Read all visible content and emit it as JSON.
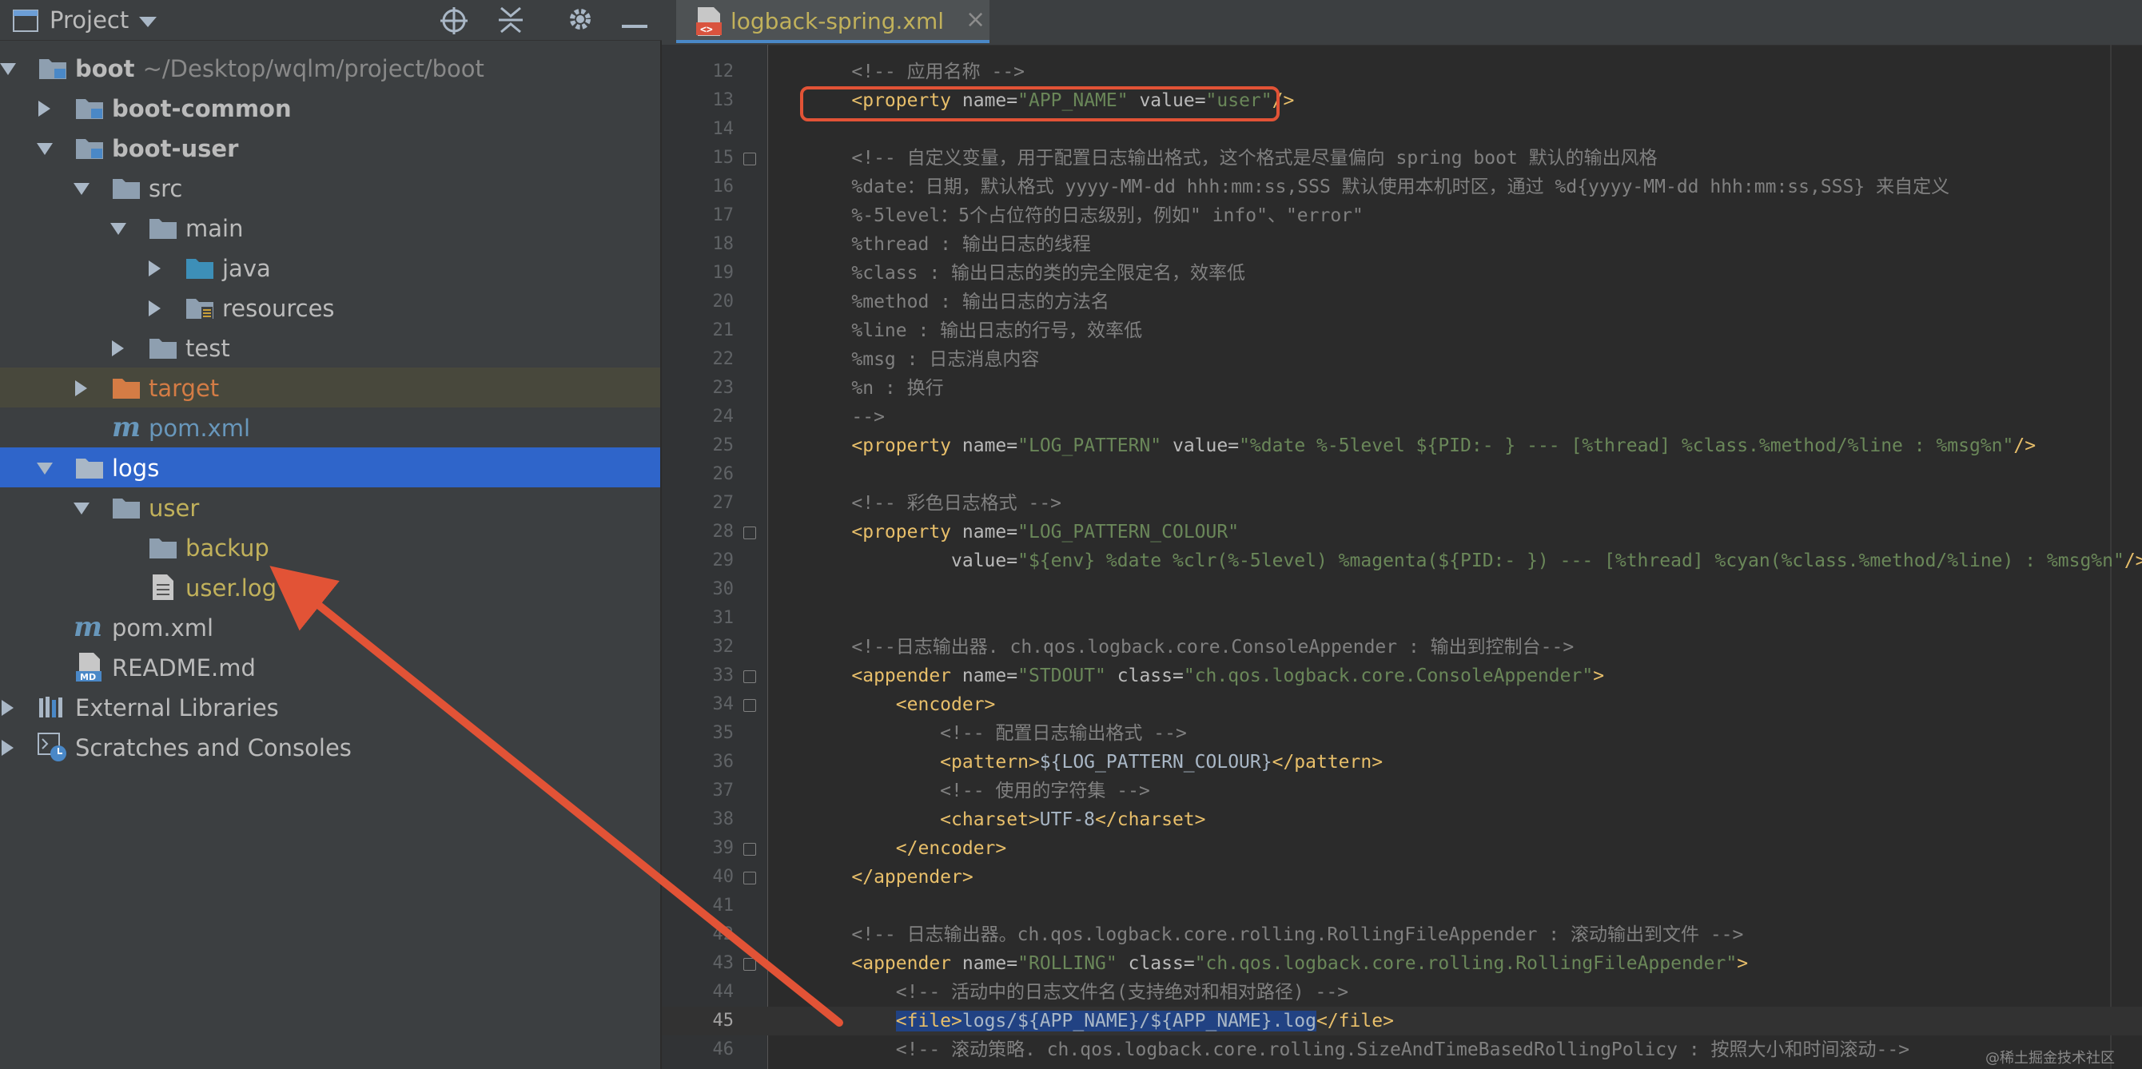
{
  "project_panel": {
    "title": "Project",
    "icons": [
      "window-icon",
      "dropdown-icon",
      "locate-icon",
      "collapse-icon",
      "gear-icon",
      "minimize-icon"
    ],
    "tree": [
      {
        "label": "boot",
        "hint": "~/Desktop/wqlm/project/boot"
      },
      {
        "label": "boot-common"
      },
      {
        "label": "boot-user"
      },
      {
        "label": "src"
      },
      {
        "label": "main"
      },
      {
        "label": "java"
      },
      {
        "label": "resources"
      },
      {
        "label": "test"
      },
      {
        "label": "target"
      },
      {
        "label": "pom.xml"
      },
      {
        "label": "logs"
      },
      {
        "label": "user"
      },
      {
        "label": "backup"
      },
      {
        "label": "user.log"
      },
      {
        "label": "pom.xml"
      },
      {
        "label": "README.md"
      },
      {
        "label": "External Libraries"
      },
      {
        "label": "Scratches and Consoles"
      }
    ]
  },
  "editor": {
    "tab_label": "logback-spring.xml",
    "tab_close": "×",
    "current_line": "45",
    "line_numbers": [
      "12",
      "13",
      "14",
      "15",
      "16",
      "17",
      "18",
      "19",
      "20",
      "21",
      "22",
      "23",
      "24",
      "25",
      "26",
      "27",
      "28",
      "29",
      "30",
      "31",
      "32",
      "33",
      "34",
      "35",
      "36",
      "37",
      "38",
      "39",
      "40",
      "41",
      "42",
      "43",
      "44",
      "45",
      "46"
    ],
    "lines": [
      [
        [
          "c-com",
          "    <!-- 应用名称 -->"
        ]
      ],
      [
        [
          "c-tag",
          "    <property "
        ],
        [
          "c-attr",
          "name="
        ],
        [
          "c-str",
          "\"APP_NAME\""
        ],
        [
          "c-attr",
          " value="
        ],
        [
          "c-str",
          "\"user\""
        ],
        [
          "c-tag",
          "/>"
        ]
      ],
      [],
      [
        [
          "c-com",
          "    <!-- 自定义变量，用于配置日志输出格式，这个格式是尽量偏向 spring boot 默认的输出风格"
        ]
      ],
      [
        [
          "c-com",
          "    %date：日期，默认格式 yyyy-MM-dd hhh:mm:ss,SSS 默认使用本机时区，通过 %d{yyyy-MM-dd hhh:mm:ss,SSS} 来自定义"
        ]
      ],
      [
        [
          "c-com",
          "    %-5level：5个占位符的日志级别，例如\" info\"、\"error\""
        ]
      ],
      [
        [
          "c-com",
          "    %thread : 输出日志的线程"
        ]
      ],
      [
        [
          "c-com",
          "    %class : 输出日志的类的完全限定名，效率低"
        ]
      ],
      [
        [
          "c-com",
          "    %method : 输出日志的方法名"
        ]
      ],
      [
        [
          "c-com",
          "    %line : 输出日志的行号，效率低"
        ]
      ],
      [
        [
          "c-com",
          "    %msg : 日志消息内容"
        ]
      ],
      [
        [
          "c-com",
          "    %n : 换行"
        ]
      ],
      [
        [
          "c-com",
          "    -->"
        ]
      ],
      [
        [
          "c-tag",
          "    <property "
        ],
        [
          "c-attr",
          "name="
        ],
        [
          "c-str",
          "\"LOG_PATTERN\""
        ],
        [
          "c-attr",
          " value="
        ],
        [
          "c-str",
          "\"%date %-5level ${PID:- } --- [%thread] %class.%method/%line : %msg%n\""
        ],
        [
          "c-tag",
          "/>"
        ]
      ],
      [],
      [
        [
          "c-com",
          "    <!-- 彩色日志格式 -->"
        ]
      ],
      [
        [
          "c-tag",
          "    <property "
        ],
        [
          "c-attr",
          "name="
        ],
        [
          "c-str",
          "\"LOG_PATTERN_COLOUR\""
        ]
      ],
      [
        [
          "c-attr",
          "             value="
        ],
        [
          "c-str",
          "\"${env} %date %clr(%-5level) %magenta(${PID:- }) --- [%thread] %cyan(%class.%method/%line) : %msg%n\""
        ],
        [
          "c-tag",
          "/>"
        ]
      ],
      [],
      [],
      [
        [
          "c-com",
          "    <!--日志输出器. ch.qos.logback.core.ConsoleAppender : 输出到控制台-->"
        ]
      ],
      [
        [
          "c-tag",
          "    <appender "
        ],
        [
          "c-attr",
          "name="
        ],
        [
          "c-str",
          "\"STDOUT\""
        ],
        [
          "c-attr",
          " class="
        ],
        [
          "c-str",
          "\"ch.qos.logback.core.ConsoleAppender\""
        ],
        [
          "c-tag",
          ">"
        ]
      ],
      [
        [
          "c-tag",
          "        <encoder>"
        ]
      ],
      [
        [
          "c-com",
          "            <!-- 配置日志输出格式 -->"
        ]
      ],
      [
        [
          "c-tag",
          "            <pattern>"
        ],
        [
          "c-txt",
          "${LOG_PATTERN_COLOUR}"
        ],
        [
          "c-tag",
          "</pattern>"
        ]
      ],
      [
        [
          "c-com",
          "            <!-- 使用的字符集 -->"
        ]
      ],
      [
        [
          "c-tag",
          "            <charset>"
        ],
        [
          "c-txt",
          "UTF-8"
        ],
        [
          "c-tag",
          "</charset>"
        ]
      ],
      [
        [
          "c-tag",
          "        </encoder>"
        ]
      ],
      [
        [
          "c-tag",
          "    </appender>"
        ]
      ],
      [],
      [
        [
          "c-com",
          "    <!-- 日志输出器。ch.qos.logback.core.rolling.RollingFileAppender : 滚动输出到文件 -->"
        ]
      ],
      [
        [
          "c-tag",
          "    <appender "
        ],
        [
          "c-attr",
          "name="
        ],
        [
          "c-str",
          "\"ROLLING\""
        ],
        [
          "c-attr",
          " class="
        ],
        [
          "c-str",
          "\"ch.qos.logback.core.rolling.RollingFileAppender\""
        ],
        [
          "c-tag",
          ">"
        ]
      ],
      [
        [
          "c-com",
          "        <!-- 活动中的日志文件名(支持绝对和相对路径) -->"
        ]
      ],
      [
        [
          "c-txt",
          "        "
        ],
        [
          "c-tag c-sel",
          "<file>"
        ],
        [
          "c-txt c-sel",
          "logs/${APP_NAME}/${APP_NAME}.log"
        ],
        [
          "c-tag",
          "</file>"
        ]
      ],
      [
        [
          "c-com",
          "        <!-- 滚动策略. ch.qos.logback.core.rolling.SizeAndTimeBasedRollingPolicy : 按照大小和时间滚动-->"
        ]
      ]
    ]
  },
  "watermark": "@稀土掘金技术社区",
  "colors": {
    "panel_bg": "#3c3f41",
    "editor_bg": "#2b2b2b",
    "selection": "#2f65ca",
    "annotation": "#e25336",
    "tag": "#e8bf6a",
    "string": "#6a8759",
    "comment": "#808080"
  }
}
